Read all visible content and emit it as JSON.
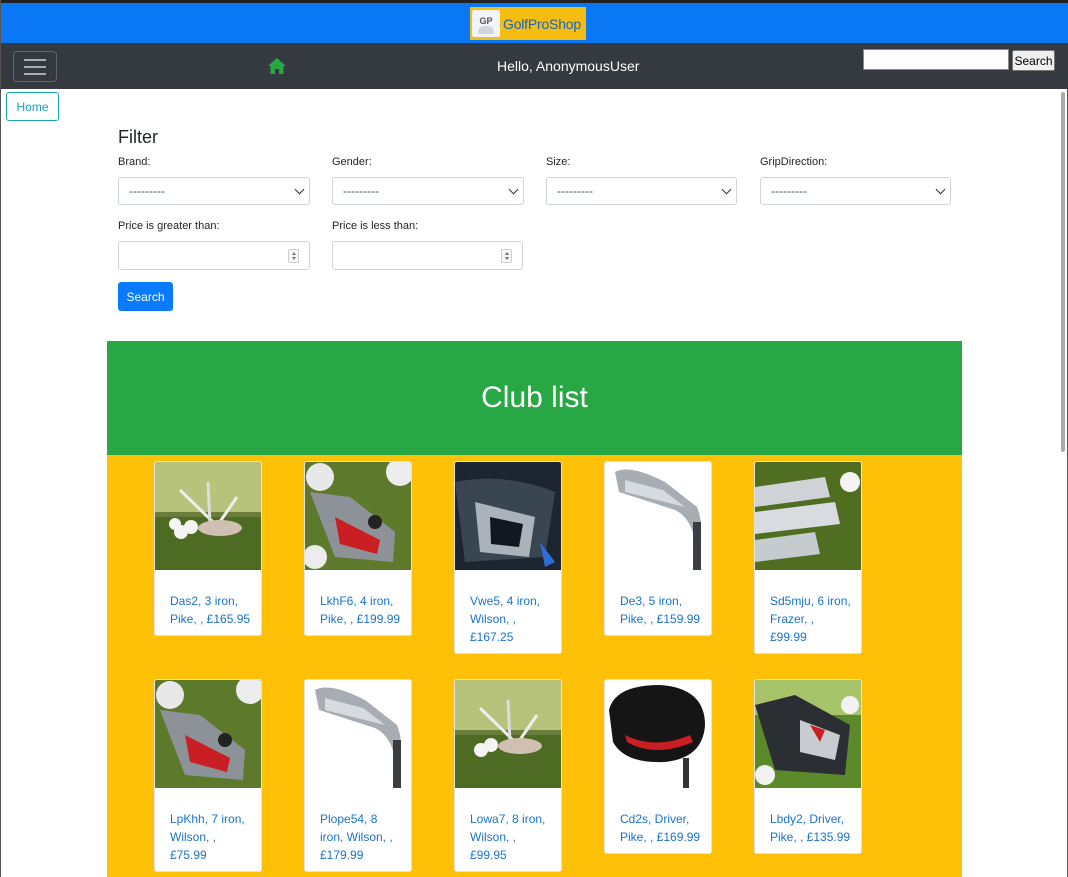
{
  "brand": {
    "logo_badge": "GP",
    "logo_text": "GolfProShop"
  },
  "navbar": {
    "greeting": "Hello, AnonymousUser",
    "search_button": "Search",
    "search_value": ""
  },
  "breadcrumb": {
    "home": "Home"
  },
  "filter": {
    "title": "Filter",
    "fields": {
      "brand": {
        "label": "Brand:",
        "value": "---------"
      },
      "gender": {
        "label": "Gender:",
        "value": "---------"
      },
      "size": {
        "label": "Size:",
        "value": "---------"
      },
      "grip": {
        "label": "GripDirection:",
        "value": "---------"
      },
      "price_gt": {
        "label": "Price is greater than:",
        "value": ""
      },
      "price_lt": {
        "label": "Price is less than:",
        "value": ""
      }
    },
    "search_button": "Search"
  },
  "club_list": {
    "title": "Club list",
    "items": [
      {
        "text": "Das2, 3 iron, Pike, , £165.95",
        "image": "irons-on-grass-with-balls"
      },
      {
        "text": "LkhF6, 4 iron, Pike, , £199.99",
        "image": "iron-closeup-red-accent"
      },
      {
        "text": "Vwe5, 4 iron, Wilson, , £167.25",
        "image": "iron-set-dark"
      },
      {
        "text": "De3, 5 iron, Pike, , £159.99",
        "image": "chrome-iron-white-bg"
      },
      {
        "text": "Sd5mju, 6 iron, Frazer, , £99.99",
        "image": "wedges-on-grass"
      },
      {
        "text": "LpKhh, 7 iron, Wilson, , £75.99",
        "image": "iron-closeup-red-accent"
      },
      {
        "text": "Plope54, 8 iron, Wilson, , £179.99",
        "image": "chrome-iron-white-bg"
      },
      {
        "text": "Lowa7, 8 iron, Wilson, , £99.95",
        "image": "irons-on-grass-with-balls"
      },
      {
        "text": "Cd2s, Driver, Pike, , £169.99",
        "image": "black-driver-red-accent"
      },
      {
        "text": "Lbdy2, Driver, Pike, , £135.99",
        "image": "driver-on-grass"
      }
    ]
  }
}
